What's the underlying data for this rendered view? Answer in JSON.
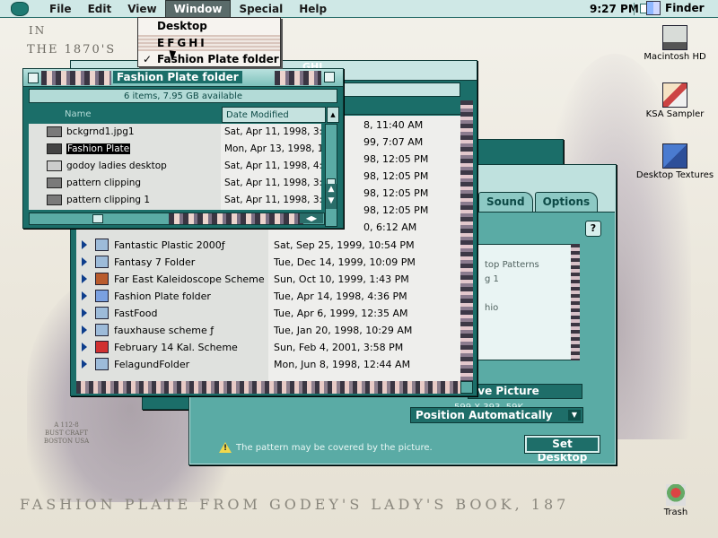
{
  "menubar": {
    "items": [
      "File",
      "Edit",
      "View",
      "Window",
      "Special",
      "Help"
    ],
    "active_item": "Window",
    "time": "9:27 PM",
    "app_name": "Finder"
  },
  "window_menu": {
    "items": [
      {
        "label": "Desktop",
        "checked": false
      },
      {
        "label": "EFGHI",
        "checked": false
      },
      {
        "label": "Fashion Plate folder",
        "checked": true
      }
    ],
    "check_mark": "✓"
  },
  "desktop": {
    "background_text_in": "IN",
    "background_text_year": "THE 1870'S",
    "background_bottom_text": "FASHION PLATE FROM GODEY'S LADY'S BOOK, 187",
    "background_maker_text": "A 112-8\nBUST CRAFT\nBOSTON USA",
    "icons": [
      {
        "label": "Macintosh HD",
        "icon": "hard-disk-icon"
      },
      {
        "label": "KSA Sampler",
        "icon": "ksa-sampler-icon"
      },
      {
        "label": "Desktop Textures",
        "icon": "desktop-textures-icon"
      },
      {
        "label": "Trash",
        "icon": "trash-icon"
      }
    ]
  },
  "fp_window": {
    "title": "Fashion Plate folder",
    "status": "6 items, 7.95 GB available",
    "col_name": "Name",
    "col_date": "Date Modified",
    "rows": [
      {
        "name": "bckgrnd1.jpg1",
        "date": "Sat, Apr 11, 1998, 3:3",
        "selected": false
      },
      {
        "name": "Fashion Plate",
        "date": "Mon, Apr 13, 1998, 1:",
        "selected": true
      },
      {
        "name": "godoy ladies desktop",
        "date": "Sat, Apr 11, 1998, 4:0",
        "selected": false
      },
      {
        "name": "pattern clipping",
        "date": "Sat, Apr 11, 1998, 3:3",
        "selected": false
      },
      {
        "name": "pattern clipping 1",
        "date": "Sat, Apr 11, 1998, 3:3",
        "selected": false
      }
    ]
  },
  "list_window": {
    "title_fragment": "GHI",
    "top_dates": [
      "8, 11:40 AM",
      "99, 7:07 AM",
      "98, 12:05 PM",
      "98, 12:05 PM",
      "98, 12:05 PM",
      "98, 12:05 PM",
      "0, 6:12 AM"
    ],
    "rows": [
      {
        "name": "Fantastic Plastic 2000ƒ",
        "date": "Sat, Sep 25, 1999, 10:54 PM"
      },
      {
        "name": "Fantasy 7 Folder",
        "date": "Tue, Dec 14, 1999, 10:09 PM"
      },
      {
        "name": "Far East Kaleidoscope Scheme",
        "date": "Sun, Oct 10, 1999, 1:43 PM"
      },
      {
        "name": "Fashion Plate folder",
        "date": "Tue, Apr 14, 1998, 4:36 PM"
      },
      {
        "name": "FastFood",
        "date": "Tue, Apr 6, 1999, 12:35 AM"
      },
      {
        "name": "fauxhause scheme  ƒ",
        "date": "Tue, Jan 20, 1998, 10:29 AM"
      },
      {
        "name": "February 14 Kal. Scheme",
        "date": "Sun, Feb 4, 2001, 3:58 PM"
      },
      {
        "name": "FelagundFolder",
        "date": "Mon, Jun 8, 1998, 12:44 AM"
      }
    ]
  },
  "control_panel": {
    "tabs": [
      "Sound",
      "Options"
    ],
    "help_label": "?",
    "list_items": [
      "top Patterns",
      "g 1",
      "",
      "hio"
    ],
    "remove_button": "ove Picture",
    "size_text": "599 X 393, 59K",
    "position_label": "Position Automatically",
    "warning_text": "The pattern may be covered by the picture.",
    "set_button": "Set Desktop"
  }
}
